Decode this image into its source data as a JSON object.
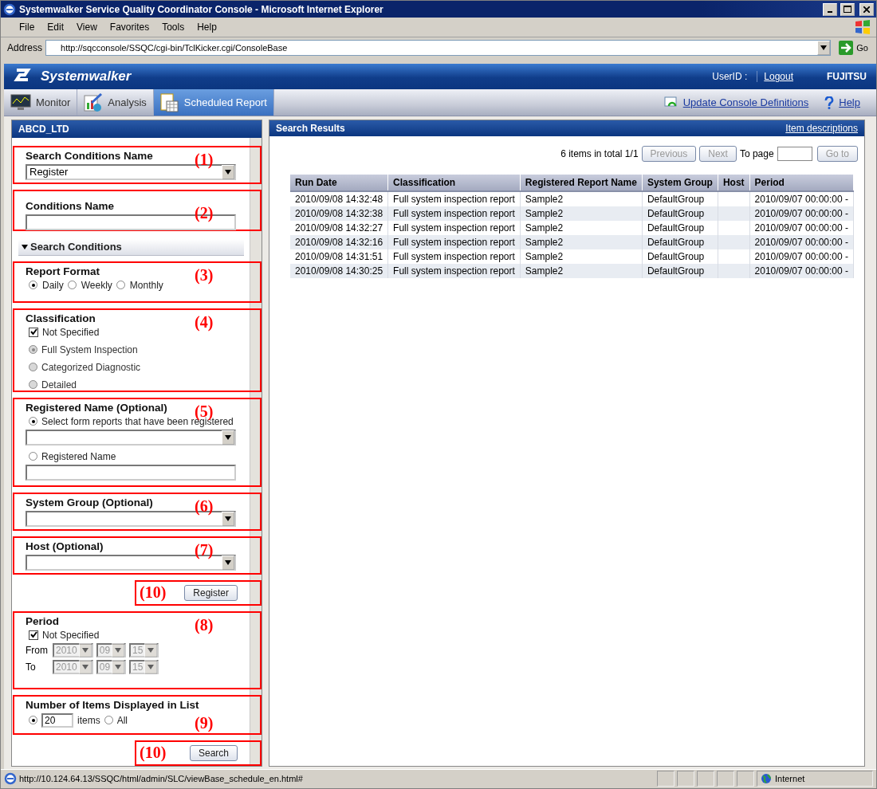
{
  "window": {
    "title": "Systemwalker Service Quality Coordinator Console - Microsoft Internet Explorer"
  },
  "menu": [
    "File",
    "Edit",
    "View",
    "Favorites",
    "Tools",
    "Help"
  ],
  "address": {
    "label": "Address",
    "value": "http://sqcconsole/SSQC/cgi-bin/TclKicker.cgi/ConsoleBase",
    "go": "Go"
  },
  "header": {
    "brand": "Systemwalker",
    "user_label": "UserID :",
    "logout": "Logout",
    "vendor": "FUJITSU"
  },
  "tabs": [
    {
      "label": "Monitor",
      "selected": false,
      "kind": "monitor"
    },
    {
      "label": "Analysis",
      "selected": false,
      "kind": "analysis"
    },
    {
      "label": "Scheduled Report",
      "selected": true,
      "kind": "calendar"
    }
  ],
  "toolbar_links": [
    {
      "label": "Update Console Definitions",
      "kind": "refresh"
    },
    {
      "label": "Help",
      "kind": "help"
    }
  ],
  "left_panel": {
    "title": "ABCD_LTD",
    "sections": [
      {
        "kind": "select",
        "callout": "(1)",
        "label": "Search Conditions Name",
        "value": "Register"
      },
      {
        "kind": "text",
        "callout": "(2)",
        "label": "Conditions Name"
      },
      {
        "kind": "expander",
        "label": "Search Conditions",
        "expanded": true
      },
      {
        "kind": "radios",
        "callout": "(3)",
        "label": "Report Format",
        "options": [
          {
            "label": "Daily",
            "selected": true
          },
          {
            "label": "Weekly",
            "selected": false
          },
          {
            "label": "Monthly",
            "selected": false
          }
        ]
      },
      {
        "kind": "classification",
        "callout": "(4)",
        "label": "Classification",
        "checkbox": {
          "label": "Not Specified",
          "checked": true
        },
        "options": [
          {
            "label": "Full System Inspection",
            "selected": true,
            "disabled": true
          },
          {
            "label": "Categorized Diagnostic",
            "selected": false,
            "disabled": true
          },
          {
            "label": "Detailed",
            "selected": false,
            "disabled": true
          }
        ]
      },
      {
        "kind": "registered",
        "callout": "(5)",
        "label": "Registered Name (Optional)",
        "options": [
          {
            "label": "Select form reports that have been registered",
            "selected": true
          },
          {
            "label": "Registered Name",
            "selected": false
          }
        ]
      },
      {
        "kind": "select",
        "callout": "(6)",
        "label": "System Group (Optional)"
      },
      {
        "kind": "select",
        "callout": "(7)",
        "label": "Host (Optional)"
      },
      {
        "kind": "button",
        "callout": "(10)",
        "button": "Register"
      },
      {
        "kind": "period",
        "callout": "(8)",
        "label": "Period",
        "checkbox": {
          "label": "Not Specified",
          "checked": true
        },
        "disabled": true,
        "rows": [
          {
            "label": "From",
            "parts": [
              "2010",
              "09",
              "15"
            ]
          },
          {
            "label": "To",
            "parts": [
              "2010",
              "09",
              "15"
            ]
          }
        ]
      },
      {
        "kind": "count",
        "callout": "(9)",
        "label": "Number of Items Displayed in List",
        "value": "20",
        "unit": "items",
        "options": [
          {
            "selected": true
          },
          {
            "label": "All",
            "selected": false
          }
        ]
      },
      {
        "kind": "button",
        "callout": "(10)",
        "button": "Search"
      }
    ]
  },
  "results": {
    "title": "Search Results",
    "link": "Item descriptions",
    "summary": "6 items in total 1/1",
    "pager_buttons": [
      {
        "label": "Previous",
        "disabled": true
      },
      {
        "label": "Next",
        "disabled": true
      }
    ],
    "page_label": "To page",
    "go": {
      "label": "Go to",
      "disabled": true
    },
    "table": {
      "columns": [
        "Run Date",
        "Classification",
        "Registered Report Name",
        "System Group",
        "Host",
        "Period"
      ],
      "rows": [
        [
          "2010/09/08 14:32:48",
          "Full system inspection report",
          "Sample2",
          "DefaultGroup",
          "",
          "2010/09/07 00:00:00 -"
        ],
        [
          "2010/09/08 14:32:38",
          "Full system inspection report",
          "Sample2",
          "DefaultGroup",
          "",
          "2010/09/07 00:00:00 -"
        ],
        [
          "2010/09/08 14:32:27",
          "Full system inspection report",
          "Sample2",
          "DefaultGroup",
          "",
          "2010/09/07 00:00:00 -"
        ],
        [
          "2010/09/08 14:32:16",
          "Full system inspection report",
          "Sample2",
          "DefaultGroup",
          "",
          "2010/09/07 00:00:00 -"
        ],
        [
          "2010/09/08 14:31:51",
          "Full system inspection report",
          "Sample2",
          "DefaultGroup",
          "",
          "2010/09/07 00:00:00 -"
        ],
        [
          "2010/09/08 14:30:25",
          "Full system inspection report",
          "Sample2",
          "DefaultGroup",
          "",
          "2010/09/07 00:00:00 -"
        ]
      ]
    }
  },
  "status_bar": {
    "url": "http://10.124.64.13/SSQC/html/admin/SLC/viewBase_schedule_en.html#",
    "zone": "Internet"
  }
}
